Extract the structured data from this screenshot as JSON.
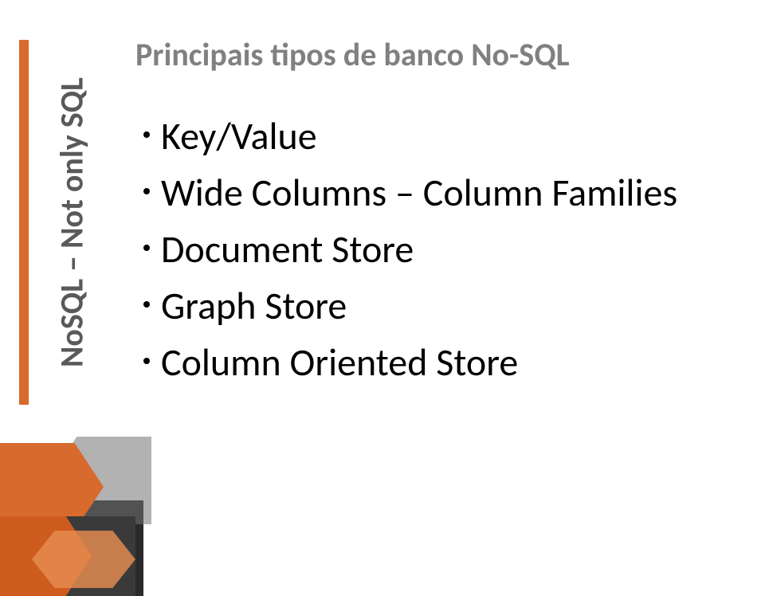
{
  "sidebar": {
    "label": "NoSQL – Not only SQL"
  },
  "title": "Principais tipos de banco No-SQL",
  "bullets": [
    "Key/Value",
    "Wide Columns – Column Families",
    "Document Store",
    "Graph Store",
    "Column Oriented Store"
  ],
  "colors": {
    "accent": "#d86a2d",
    "title": "#808080",
    "sidebar_text": "#595959"
  }
}
